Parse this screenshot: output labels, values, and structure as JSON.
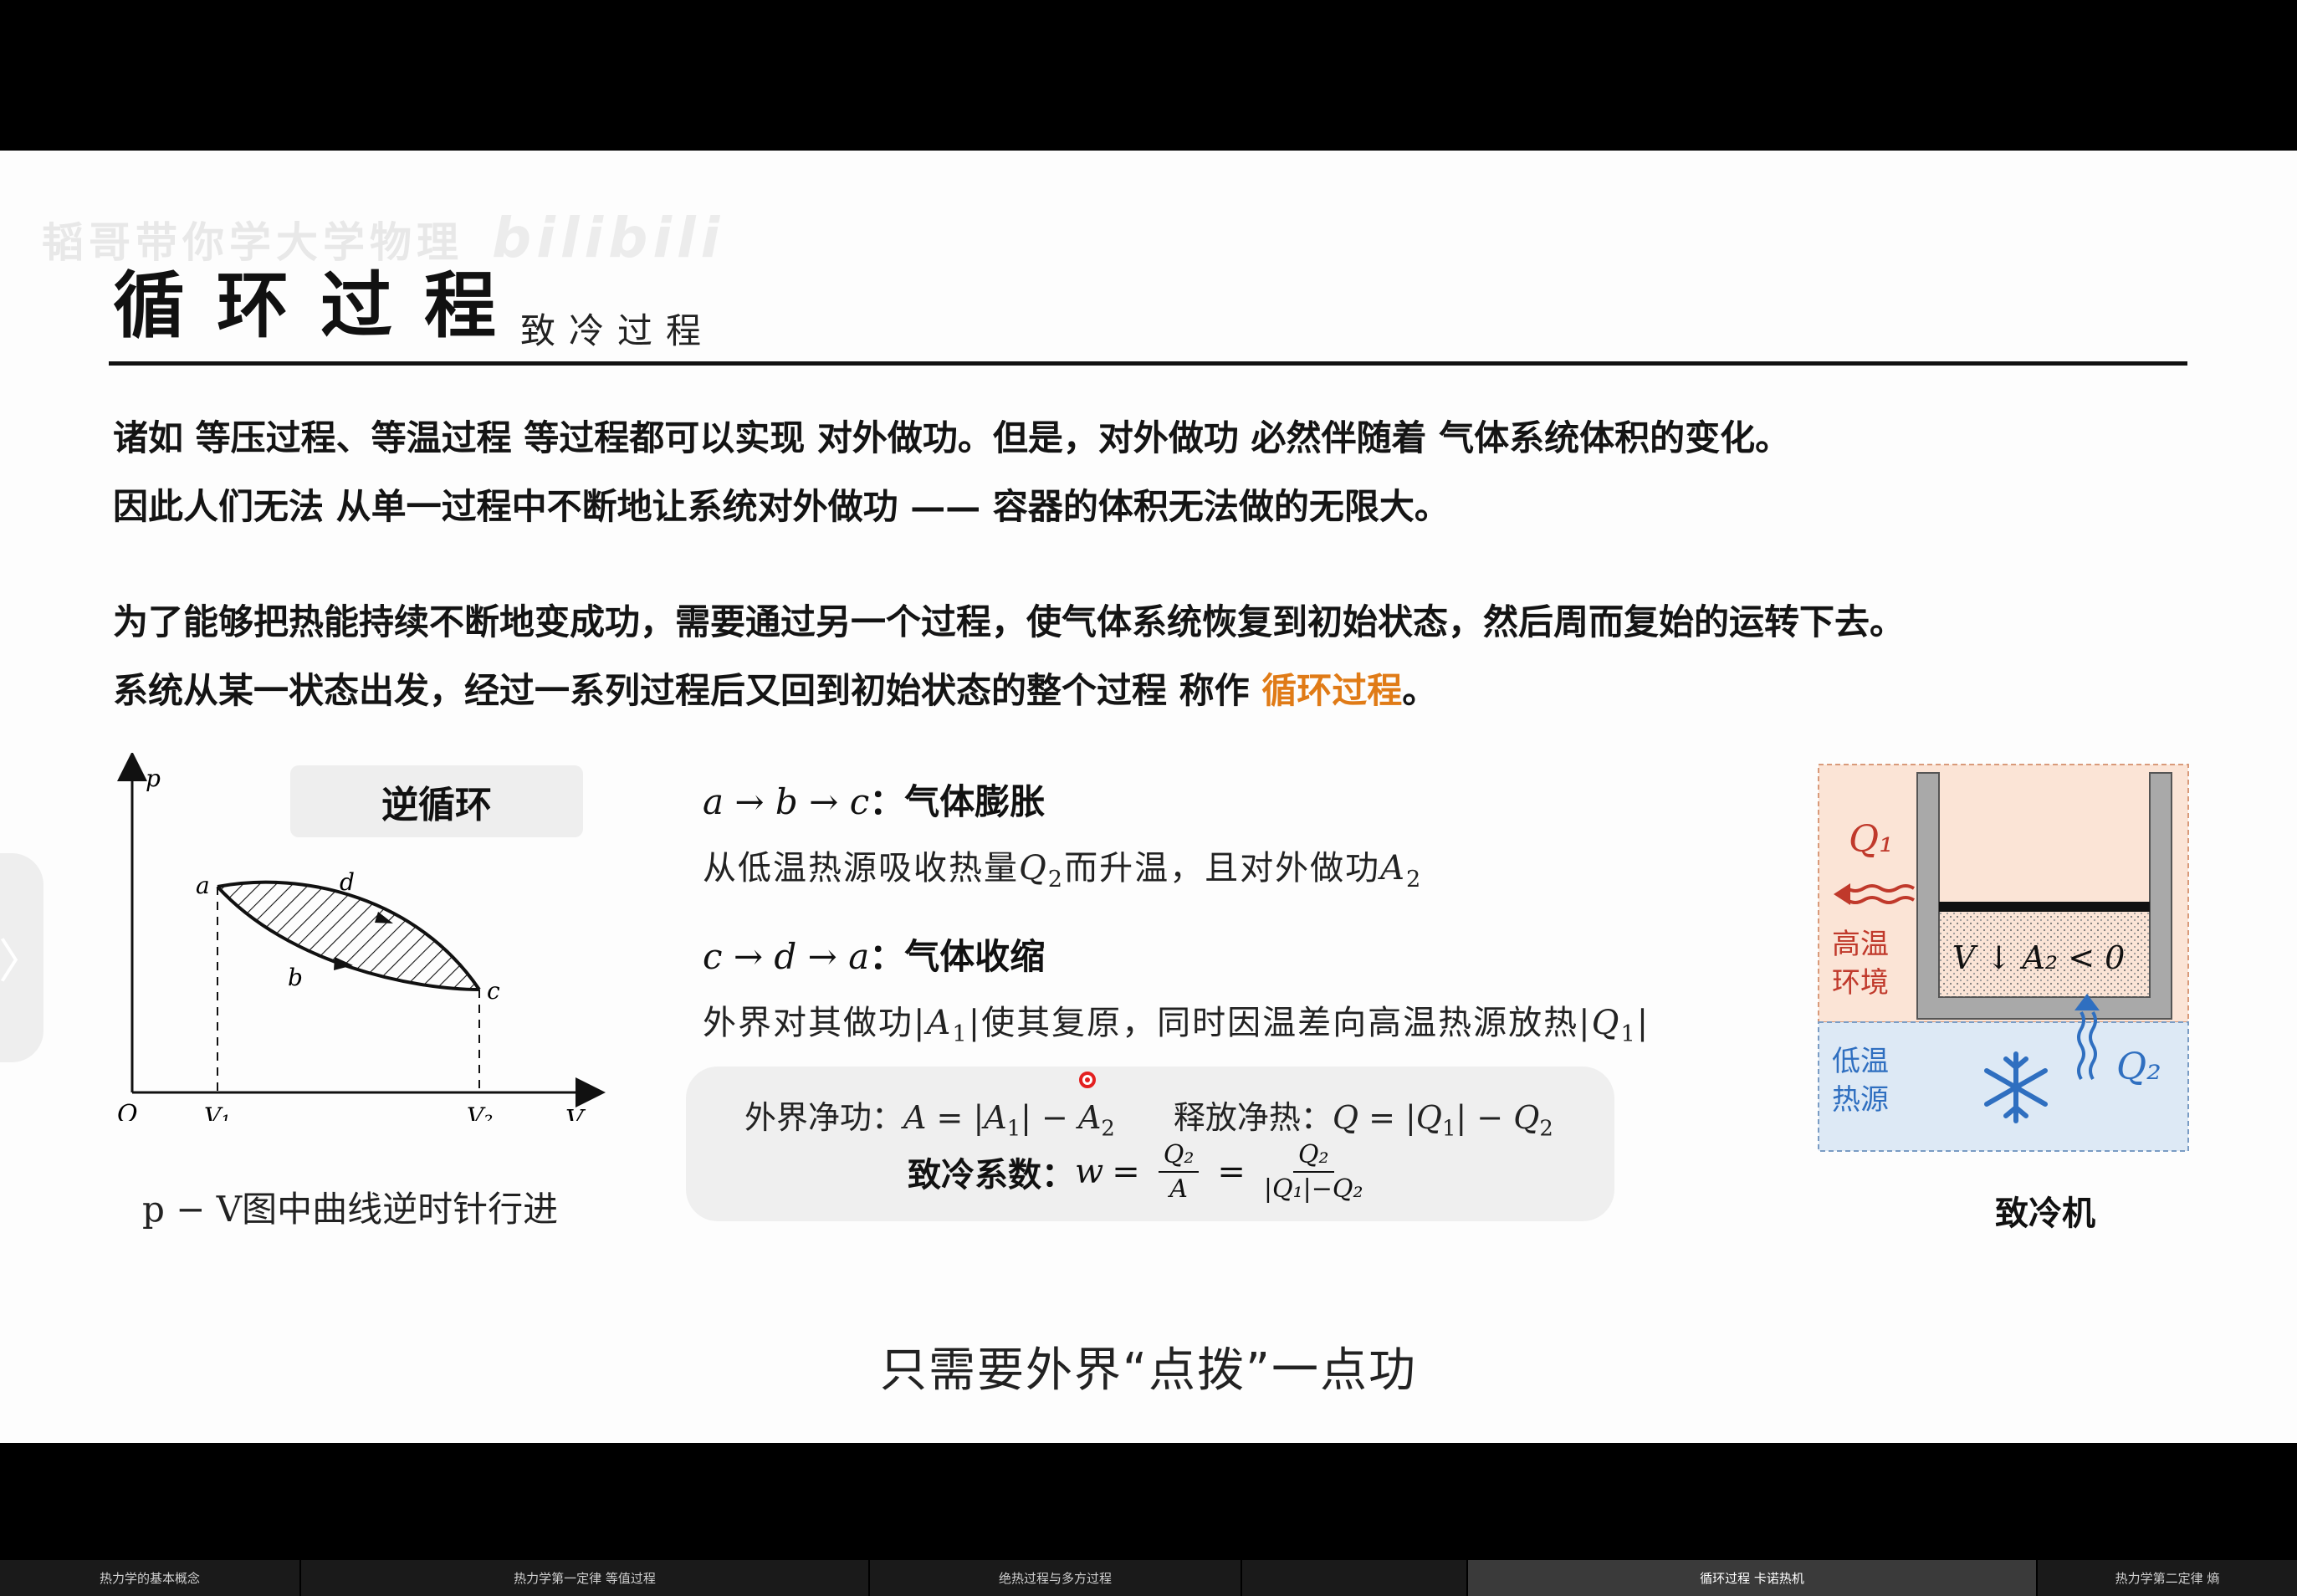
{
  "watermark": {
    "text": "韬哥带你学大学物理",
    "logo": "bilibili"
  },
  "title": "循环过程",
  "subtitle": "致冷过程",
  "paragraphs": {
    "p1": "诸如 等压过程、等温过程 等过程都可以实现 对外做功。但是，对外做功 必然伴随着 气体系统体积的变化。",
    "p2": "因此人们无法 从单一过程中不断地让系统对外做功 —— 容器的体积无法做的无限大。",
    "p3": "为了能够把热能持续不断地变成功，需要通过另一个过程，使气体系统恢复到初始状态，然后周而复始的运转下去。",
    "p4_prefix": "系统从某一状态出发，经过一系列过程后又回到初始状态的整个过程 称作 ",
    "p4_highlight": "循环过程",
    "p4_suffix": "。"
  },
  "graph": {
    "badge": "逆循环",
    "axis_p": "p",
    "axis_v": "V",
    "origin": "O",
    "v1": "V₁",
    "v2": "V₂",
    "pt_a": "a",
    "pt_b": "b",
    "pt_c": "c",
    "pt_d": "d",
    "caption": "p − V图中曲线逆时针行进"
  },
  "process1": {
    "path": "a → b → c",
    "colon": "：",
    "label": "气体膨胀",
    "desc_a": "从低温热源吸收热量",
    "desc_q": "Q",
    "desc_qsub": "2",
    "desc_b": "而升温，且对外做功",
    "desc_a2": "A",
    "desc_a2sub": "2"
  },
  "process2": {
    "path": "c → d → a",
    "colon": "：",
    "label": "气体收缩",
    "desc_a": "外界对其做功",
    "desc_m1": "|A",
    "desc_m1sub": "1",
    "desc_m1end": "|",
    "desc_b": "使其复原，同时因温差向高温热源放热",
    "desc_m2": "|Q",
    "desc_m2sub": "1",
    "desc_m2end": "|"
  },
  "formula": {
    "work_label": "外界净功：",
    "work_expr_a": "A = |A",
    "work_sub1": "1",
    "work_expr_b": "| − A",
    "work_sub2": "2",
    "heat_label": "释放净热：",
    "heat_expr_a": "Q = |Q",
    "heat_sub1": "1",
    "heat_expr_b": "| − Q",
    "heat_sub2": "2",
    "coef_label": "致冷系数：",
    "coef_w": "w",
    "frac1_num": "Q₂",
    "frac1_den": "A",
    "frac2_num": "Q₂",
    "frac2_den": "|Q₁|−Q₂"
  },
  "fridge": {
    "q1": "Q₁",
    "q2": "Q₂",
    "hot_line1": "高温",
    "hot_line2": "环境",
    "cold_line1": "低温",
    "cold_line2": "热源",
    "gas_label": "V ↓  A₂ < 0",
    "caption": "致冷机",
    "colors": {
      "hot_bg": "#fbe4d6",
      "cold_bg": "#dde9f5",
      "hot_text": "#c0392b",
      "cold_text": "#2f6fc0"
    }
  },
  "video_subtitle": "只需要外界“点拨”一点功",
  "nav_arrow": "〉",
  "chapters": [
    {
      "label": "热力学的基本概念",
      "active": false
    },
    {
      "label": "热力学第一定律 等值过程",
      "active": false
    },
    {
      "label": "绝热过程与多方过程",
      "active": false
    },
    {
      "label": "循环过程 卡诺热机",
      "active": true
    },
    {
      "label": "热力学第二定律 熵",
      "active": false
    }
  ],
  "accent_color": "#e07b17"
}
